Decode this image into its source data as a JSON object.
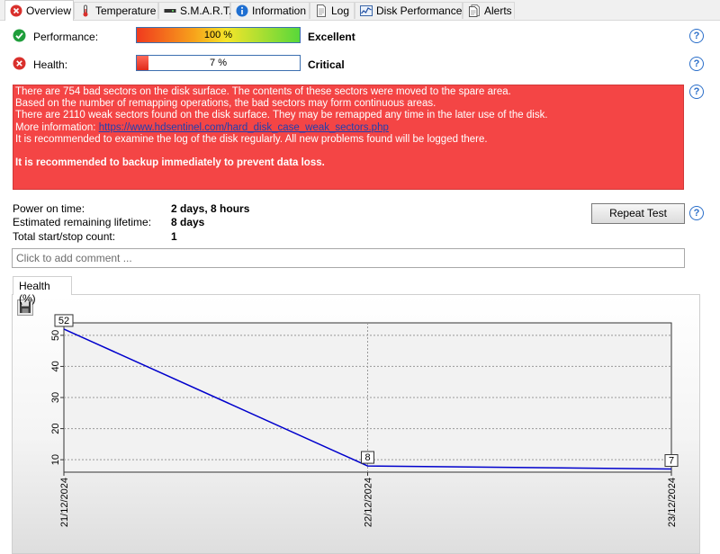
{
  "tabs": [
    {
      "label": "Overview",
      "icon": "error-icon"
    },
    {
      "label": "Temperature",
      "icon": "thermometer-icon"
    },
    {
      "label": "S.M.A.R.T.",
      "icon": "disk-icon"
    },
    {
      "label": "Information",
      "icon": "info-icon"
    },
    {
      "label": "Log",
      "icon": "log-icon"
    },
    {
      "label": "Disk Performance",
      "icon": "performance-chart-icon"
    },
    {
      "label": "Alerts",
      "icon": "alerts-icon"
    }
  ],
  "performance": {
    "label": "Performance:",
    "value_text": "100 %",
    "value": 100,
    "rating": "Excellent"
  },
  "health": {
    "label": "Health:",
    "value_text": "7 %",
    "value": 7,
    "rating": "Critical"
  },
  "alert": {
    "line1": "There are 754 bad sectors on the disk surface. The contents of these sectors were moved to the spare area.",
    "line2": "Based on the number of remapping operations, the bad sectors may form continuous areas.",
    "line3": "There are 2110 weak sectors found on the disk surface. They may be remapped any time in the later use of the disk.",
    "more_prefix": "More information: ",
    "more_link": "https://www.hdsentinel.com/hard_disk_case_weak_sectors.php",
    "line5": "It is recommended to examine the log of the disk regularly. All new problems found will be logged there.",
    "warning": "It is recommended to backup immediately to prevent data loss."
  },
  "stats": {
    "power_on_label": "Power on time:",
    "power_on_value": "2 days, 8 hours",
    "lifetime_label": "Estimated remaining lifetime:",
    "lifetime_value": "8 days",
    "startstop_label": "Total start/stop count:",
    "startstop_value": "1"
  },
  "repeat_button": "Repeat Test",
  "comment_placeholder": "Click to add comment ...",
  "chart_tab": "Health (%)",
  "colors": {
    "alert_bg": "#f44545",
    "line": "#0000cc",
    "accent": "#2a6ec9"
  },
  "chart_data": {
    "type": "line",
    "categories": [
      "21/12/2024",
      "22/12/2024",
      "23/12/2024"
    ],
    "series": [
      {
        "values": [
          52,
          8,
          7
        ]
      }
    ],
    "data_labels": [
      "52",
      "8",
      "7"
    ],
    "yticks": [
      "10",
      "20",
      "30",
      "40",
      "50"
    ],
    "ylim": [
      6,
      54
    ],
    "grid": true
  }
}
